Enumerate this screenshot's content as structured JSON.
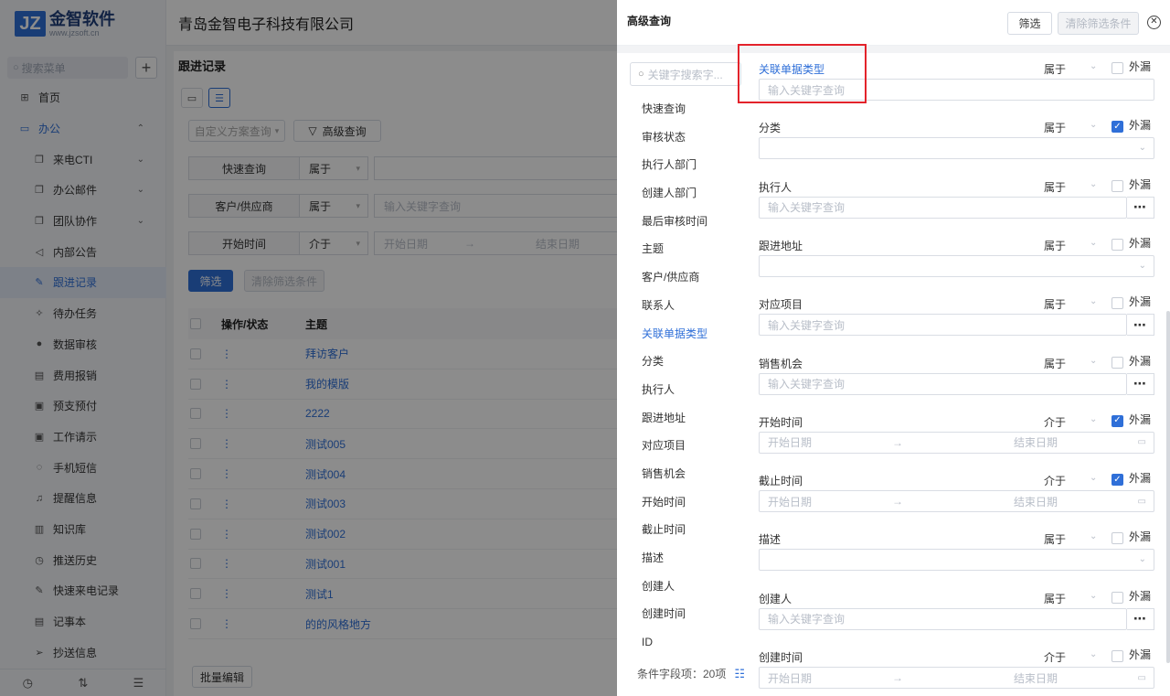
{
  "app": {
    "logo_title": "金智软件",
    "logo_url": "www.jzsoft.cn",
    "company": "青岛金智电子科技有限公司"
  },
  "sidebar": {
    "search_placeholder": "搜索菜单",
    "items": [
      {
        "label": "首页",
        "icon": "home-icon",
        "glyph": "⊞"
      },
      {
        "label": "办公",
        "icon": "office-icon",
        "glyph": "▭"
      },
      {
        "label": "来电CTI",
        "icon": "copy-icon",
        "glyph": "❐"
      },
      {
        "label": "办公邮件",
        "icon": "copy-icon",
        "glyph": "❐"
      },
      {
        "label": "团队协作",
        "icon": "copy-icon",
        "glyph": "❐"
      },
      {
        "label": "内部公告",
        "icon": "speaker-icon",
        "glyph": "◁"
      },
      {
        "label": "跟进记录",
        "icon": "edit-doc-icon",
        "glyph": "✎"
      },
      {
        "label": "待办任务",
        "icon": "pin-icon",
        "glyph": "✧"
      },
      {
        "label": "数据审核",
        "icon": "user-icon",
        "glyph": "●"
      },
      {
        "label": "费用报销",
        "icon": "receipt-icon",
        "glyph": "▤"
      },
      {
        "label": "预支预付",
        "icon": "wallet-icon",
        "glyph": "▣"
      },
      {
        "label": "工作请示",
        "icon": "report-icon",
        "glyph": "▣"
      },
      {
        "label": "手机短信",
        "icon": "message-icon",
        "glyph": "◌"
      },
      {
        "label": "提醒信息",
        "icon": "bell-icon",
        "glyph": "♫"
      },
      {
        "label": "知识库",
        "icon": "book-icon",
        "glyph": "▥"
      },
      {
        "label": "推送历史",
        "icon": "clock-icon",
        "glyph": "◷"
      },
      {
        "label": "快速来电记录",
        "icon": "edit-doc-icon",
        "glyph": "✎"
      },
      {
        "label": "记事本",
        "icon": "notebook-icon",
        "glyph": "▤"
      },
      {
        "label": "抄送信息",
        "icon": "send-icon",
        "glyph": "➢"
      }
    ]
  },
  "page": {
    "title": "跟进记录",
    "custom_query": "自定义方案查询",
    "advanced_query": "高级查询",
    "filters": [
      {
        "label": "快速查询",
        "op": "属于",
        "value": ""
      },
      {
        "label": "客户/供应商",
        "op": "属于",
        "value": "输入关键字查询"
      },
      {
        "label": "开始时间",
        "op": "介于",
        "value": "开始日期",
        "value_end": "结束日期"
      }
    ],
    "filter_btn": "筛选",
    "clear_btn": "清除筛选条件",
    "table": {
      "headers": [
        "操作/状态",
        "主题"
      ],
      "rows": [
        "拜访客户",
        "我的模版",
        "2222",
        "测试005",
        "测试004",
        "测试003",
        "测试002",
        "测试001",
        "测试1",
        "的的风格地方"
      ]
    },
    "batch_edit": "批量编辑"
  },
  "drawer": {
    "title": "高级查询",
    "filter_btn": "筛选",
    "clear_btn": "清除筛选条件",
    "field_search_placeholder": "关键字搜索字...",
    "fields": [
      "快速查询",
      "审核状态",
      "执行人部门",
      "创建人部门",
      "最后审核时间",
      "主题",
      "客户/供应商",
      "联系人",
      "关联单据类型",
      "分类",
      "执行人",
      "跟进地址",
      "对应项目",
      "销售机会",
      "开始时间",
      "截止时间",
      "描述",
      "创建人",
      "创建时间",
      "ID"
    ],
    "active_field": "关联单据类型",
    "field_count_label": "条件字段项：20项",
    "exclude_label": "外漏",
    "conditions": [
      {
        "label": "关联单据类型",
        "op": "属于",
        "checked": false,
        "kind": "text",
        "placeholder": "输入关键字查询"
      },
      {
        "label": "分类",
        "op": "属于",
        "checked": true,
        "kind": "select",
        "placeholder": ""
      },
      {
        "label": "执行人",
        "op": "属于",
        "checked": false,
        "kind": "lookup",
        "placeholder": "输入关键字查询"
      },
      {
        "label": "跟进地址",
        "op": "属于",
        "checked": false,
        "kind": "select",
        "placeholder": ""
      },
      {
        "label": "对应项目",
        "op": "属于",
        "checked": false,
        "kind": "lookup",
        "placeholder": "输入关键字查询"
      },
      {
        "label": "销售机会",
        "op": "属于",
        "checked": false,
        "kind": "lookup",
        "placeholder": "输入关键字查询"
      },
      {
        "label": "开始时间",
        "op": "介于",
        "checked": true,
        "kind": "date",
        "placeholder": "开始日期",
        "placeholder_end": "结束日期"
      },
      {
        "label": "截止时间",
        "op": "介于",
        "checked": true,
        "kind": "date",
        "placeholder": "开始日期",
        "placeholder_end": "结束日期"
      },
      {
        "label": "描述",
        "op": "属于",
        "checked": false,
        "kind": "select",
        "placeholder": ""
      },
      {
        "label": "创建人",
        "op": "属于",
        "checked": false,
        "kind": "lookup",
        "placeholder": "输入关键字查询"
      },
      {
        "label": "创建时间",
        "op": "介于",
        "checked": false,
        "kind": "date",
        "placeholder": "开始日期",
        "placeholder_end": "结束日期"
      }
    ]
  },
  "colors": {
    "accent": "#2f6fd8",
    "highlight": "#e3232b"
  }
}
